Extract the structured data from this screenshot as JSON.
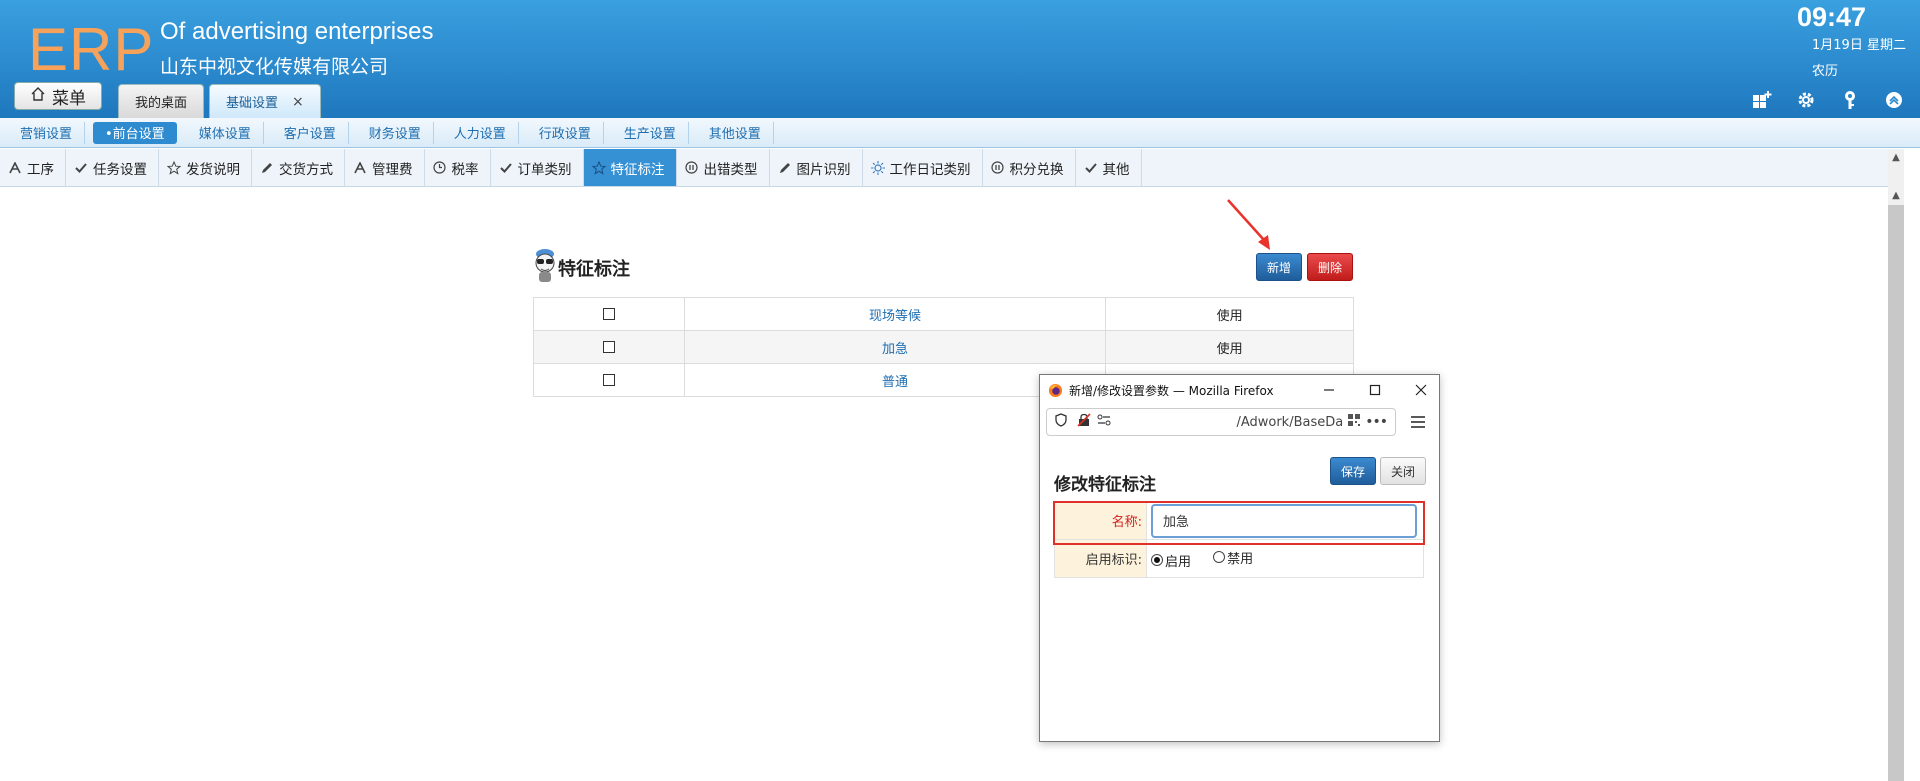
{
  "header": {
    "logo": "ERP",
    "subtitle_en": "Of advertising enterprises",
    "company_cn": "山东中视文化传媒有限公司",
    "time": "09:47",
    "date": "1月19日 星期二",
    "lunar": "农历",
    "menu_label": "菜单",
    "tabs": [
      {
        "label": "我的桌面"
      },
      {
        "label": "基础设置",
        "close": "×"
      }
    ]
  },
  "nav1": {
    "items": [
      {
        "label": "营销设置"
      },
      {
        "label": "•前台设置",
        "active": true
      },
      {
        "label": "媒体设置"
      },
      {
        "label": "客户设置"
      },
      {
        "label": "财务设置"
      },
      {
        "label": "人力设置"
      },
      {
        "label": "行政设置"
      },
      {
        "label": "生产设置"
      },
      {
        "label": "其他设置"
      }
    ]
  },
  "nav2": {
    "items": [
      {
        "label": "工序",
        "icon": "letter-a-icon"
      },
      {
        "label": "任务设置",
        "icon": "check-icon"
      },
      {
        "label": "发货说明",
        "icon": "star-icon"
      },
      {
        "label": "交货方式",
        "icon": "pencil-icon"
      },
      {
        "label": "管理费",
        "icon": "letter-a-icon"
      },
      {
        "label": "税率",
        "icon": "clock-icon"
      },
      {
        "label": "订单类别",
        "icon": "check-icon"
      },
      {
        "label": "特征标注",
        "icon": "star-icon",
        "active": true
      },
      {
        "label": "出错类型",
        "icon": "pause-icon"
      },
      {
        "label": "图片识别",
        "icon": "pencil-icon"
      },
      {
        "label": "工作日记类别",
        "icon": "sun-icon"
      },
      {
        "label": "积分兑换",
        "icon": "pause-icon"
      },
      {
        "label": "其他",
        "icon": "check-icon"
      }
    ]
  },
  "main": {
    "title": "特征标注",
    "new_label": "新增",
    "delete_label": "删除",
    "rows": [
      {
        "name": "现场等候",
        "status": "使用"
      },
      {
        "name": "加急",
        "status": "使用"
      },
      {
        "name": "普通",
        "status": ""
      }
    ]
  },
  "dialog": {
    "window_title": "新增/修改设置参数 — Mozilla Firefox",
    "url": "/Adwork/BaseDa",
    "heading": "修改特征标注",
    "save_label": "保存",
    "close_label": "关闭",
    "name_label": "名称:",
    "name_value": "加急",
    "enable_label": "启用标识:",
    "radio_on": "启用",
    "radio_off": "禁用"
  },
  "colors": {
    "header_blue": "#2a88cc",
    "logo_orange": "#f6a25a",
    "active_tab_blue": "#3691d4",
    "delete_red": "#c11c1c",
    "highlight_red": "#e0302a"
  }
}
